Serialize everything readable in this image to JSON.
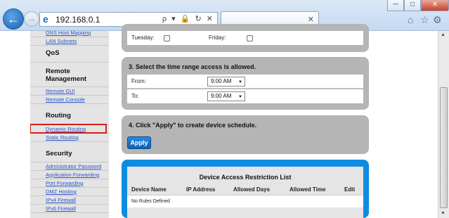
{
  "browser": {
    "url": "192.168.0.1",
    "address_tools": "ρ ▾ 🔒 ↻ ✕",
    "window_controls": {
      "minimize": "─",
      "maximize": "□",
      "close": "✕"
    },
    "back_icon": "←",
    "forward_icon": "→",
    "tab_close": "✕",
    "toolbar_icons": {
      "home": "⌂",
      "favorites": "☆",
      "tools": "⚙"
    }
  },
  "sidebar": {
    "top_links": [
      "DNS Host Mapping",
      "LAN Subnets"
    ],
    "sections": [
      {
        "title": "QoS",
        "links": []
      },
      {
        "title": "Remote Management",
        "links": [
          "Remote GUI",
          "Remote Console"
        ]
      },
      {
        "title": "Routing",
        "links": [
          "Dynamic Routing",
          "Static Routing"
        ]
      },
      {
        "title": "Security",
        "links": [
          "Administrator Password",
          "Application Forwarding",
          "Port Forwarding",
          "DMZ Hosting",
          "IPv4 Firewall",
          "IPv6 Firewall"
        ]
      }
    ],
    "highlighted": "Dynamic Routing"
  },
  "days_panel": {
    "day1": "Tuesday:",
    "day2": "Friday:"
  },
  "time_panel": {
    "title": "3. Select the time range access is allowed.",
    "from_label": "From:",
    "from_value": "9:00 AM",
    "to_label": "To:",
    "to_value": "9:00 AM"
  },
  "apply_panel": {
    "title": "4. Click \"Apply\" to create device schedule.",
    "apply_label": "Apply"
  },
  "restriction_list": {
    "title": "Device Access Restriction List",
    "columns": [
      "Device Name",
      "IP Address",
      "Allowed Days",
      "Allowed Time",
      "Edit"
    ],
    "empty_text": "No Rules Defined"
  }
}
